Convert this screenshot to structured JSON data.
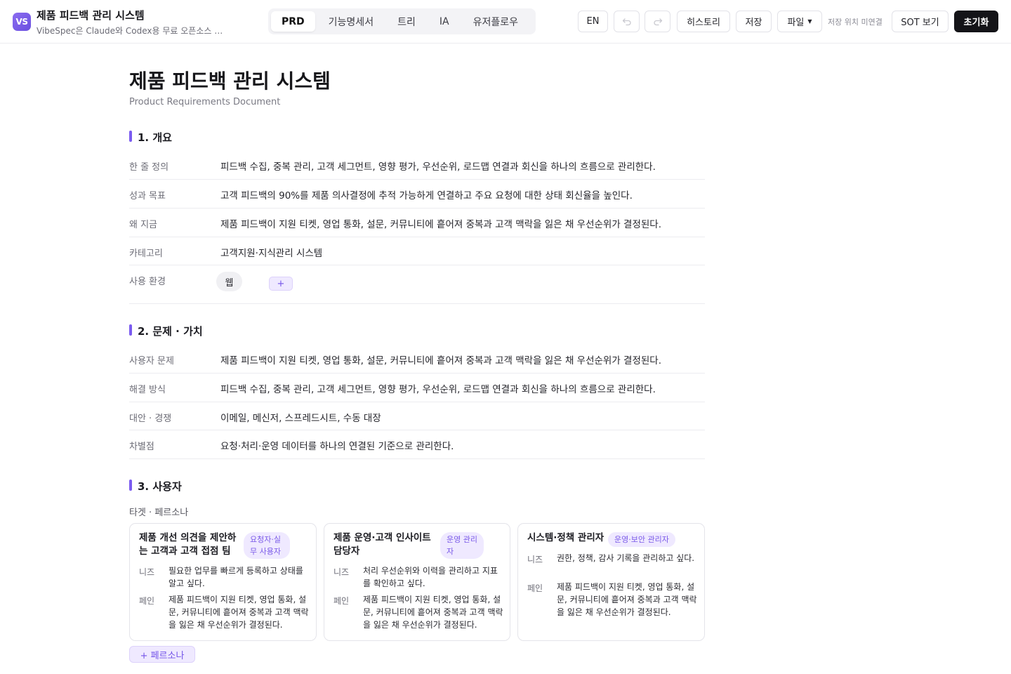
{
  "header": {
    "logo_text": "VS",
    "title": "제품 피드백 관리 시스템",
    "subtitle": "VibeSpec은 Claude와 Codex용 무료 오픈소스 AI...",
    "tabs": [
      {
        "label": "PRD",
        "active": true
      },
      {
        "label": "기능명세서",
        "active": false
      },
      {
        "label": "트리",
        "active": false
      },
      {
        "label": "IA",
        "active": false
      },
      {
        "label": "유저플로우",
        "active": false
      }
    ],
    "lang_label": "EN",
    "undo_icon": "undo-icon",
    "redo_icon": "redo-icon",
    "history_label": "히스토리",
    "save_label": "저장",
    "file_label": "파일",
    "save_status": "저장 위치 미연결",
    "sot_label": "SOT 보기",
    "reset_label": "초기화"
  },
  "doc": {
    "title": "제품 피드백 관리 시스템",
    "subtitle": "Product Requirements Document",
    "sections": {
      "overview": {
        "heading": "1. 개요",
        "rows": [
          {
            "label": "한 줄 정의",
            "value": "피드백 수집, 중복 관리, 고객 세그먼트, 영향 평가, 우선순위, 로드맵 연결과 회신을 하나의 흐름으로 관리한다."
          },
          {
            "label": "성과 목표",
            "value": "고객 피드백의 90%를 제품 의사결정에 추적 가능하게 연결하고 주요 요청에 대한 상태 회신율을 높인다."
          },
          {
            "label": "왜 지금",
            "value": "제품 피드백이 지원 티켓, 영업 통화, 설문, 커뮤니티에 흩어져 중복과 고객 맥락을 잃은 채 우선순위가 결정된다."
          },
          {
            "label": "카테고리",
            "value": "고객지원·지식관리 시스템"
          }
        ],
        "env_label": "사용 환경",
        "env_chips": [
          "웹"
        ],
        "add_label": "+"
      },
      "problem": {
        "heading": "2. 문제 · 가치",
        "rows": [
          {
            "label": "사용자 문제",
            "value": "제품 피드백이 지원 티켓, 영업 통화, 설문, 커뮤니티에 흩어져 중복과 고객 맥락을 잃은 채 우선순위가 결정된다."
          },
          {
            "label": "해결 방식",
            "value": "피드백 수집, 중복 관리, 고객 세그먼트, 영향 평가, 우선순위, 로드맵 연결과 회신을 하나의 흐름으로 관리한다."
          },
          {
            "label": "대안 · 경쟁",
            "value": "이메일, 메신저, 스프레드시트, 수동 대장"
          },
          {
            "label": "차별점",
            "value": "요청·처리·운영 데이터를 하나의 연결된 기준으로 관리한다."
          }
        ]
      },
      "users": {
        "heading": "3. 사용자",
        "subheading": "타겟 · 페르소나",
        "needs_label": "니즈",
        "pain_label": "페인",
        "personas": [
          {
            "name": "제품 개선 의견을 제안하는 고객과 고객 접점 팀",
            "badge": "요청자·실무 사용자",
            "needs": "필요한 업무를 빠르게 등록하고 상태를 알고 싶다.",
            "pain": "제품 피드백이 지원 티켓, 영업 통화, 설문, 커뮤니티에 흩어져 중복과 고객 맥락을 잃은 채 우선순위가 결정된다."
          },
          {
            "name": "제품 운영·고객 인사이트 담당자",
            "badge": "운영 관리자",
            "needs": "처리 우선순위와 이력을 관리하고 지표를 확인하고 싶다.",
            "pain": "제품 피드백이 지원 티켓, 영업 통화, 설문, 커뮤니티에 흩어져 중복과 고객 맥락을 잃은 채 우선순위가 결정된다."
          },
          {
            "name": "시스템·정책 관리자",
            "badge": "운영·보안 관리자",
            "needs": "권한, 정책, 감사 기록을 관리하고 싶다.",
            "pain": "제품 피드백이 지원 티켓, 영업 통화, 설문, 커뮤니티에 흩어져 중복과 고객 맥락을 잃은 채 우선순위가 결정된다."
          }
        ],
        "add_persona_label": "+ 페르소나"
      }
    }
  },
  "colors": {
    "accent": "#7b5cf0",
    "accent_soft": "#efe9ff",
    "primary_dark": "#141418"
  }
}
